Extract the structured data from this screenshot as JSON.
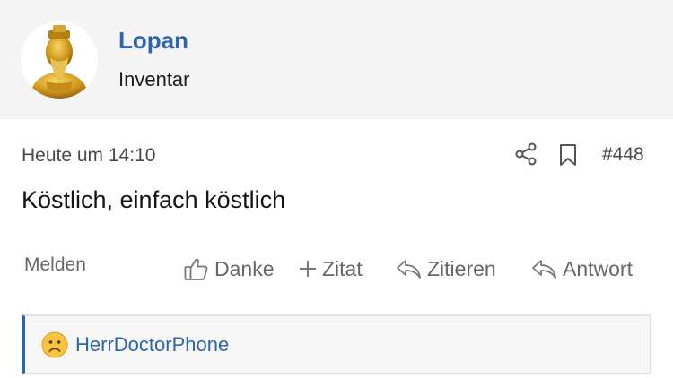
{
  "user": {
    "name": "Lopan",
    "title": "Inventar"
  },
  "post": {
    "date": "Heute um 14:10",
    "number": "#448",
    "body": "Köstlich, einfach köstlich"
  },
  "actions": {
    "report": "Melden",
    "like": "Danke",
    "multiquote": "Zitat",
    "quote": "Zitieren",
    "reply": "Antwort"
  },
  "reactions": {
    "emoji": "frowning-face",
    "user": "HerrDoctorPhone"
  },
  "colors": {
    "accent": "#2c64b0",
    "header_bg": "#f4f4f4",
    "muted": "#666666"
  }
}
